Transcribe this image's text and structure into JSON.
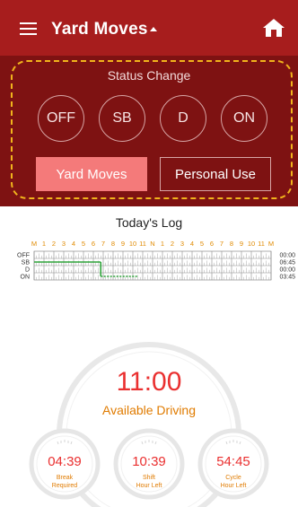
{
  "header": {
    "title": "Yard Moves"
  },
  "status_change": {
    "title": "Status Change",
    "buttons": [
      "OFF",
      "SB",
      "D",
      "ON"
    ],
    "yard_moves_label": "Yard Moves",
    "personal_use_label": "Personal Use"
  },
  "log": {
    "title": "Today's Log",
    "hour_labels": [
      "M",
      "1",
      "2",
      "3",
      "4",
      "5",
      "6",
      "7",
      "8",
      "9",
      "10",
      "11",
      "N",
      "1",
      "2",
      "3",
      "4",
      "5",
      "6",
      "7",
      "8",
      "9",
      "10",
      "11",
      "M"
    ],
    "rows": [
      {
        "label": "OFF",
        "total": "00:00"
      },
      {
        "label": "SB",
        "total": "06:45"
      },
      {
        "label": "D",
        "total": "00:00"
      },
      {
        "label": "ON",
        "total": "03:45"
      }
    ]
  },
  "timers": {
    "available_driving": {
      "value": "11:00",
      "label": "Available Driving"
    },
    "break": {
      "value": "04:39",
      "label_line1": "Break",
      "label_line2": "Required"
    },
    "shift": {
      "value": "10:39",
      "label_line1": "Shift",
      "label_line2": "Hour Left"
    },
    "cycle": {
      "value": "54:45",
      "label_line1": "Cycle",
      "label_line2": "Hour Left"
    }
  },
  "colors": {
    "app_bar": "#a71d1d",
    "status_panel": "#7e1212",
    "highlight_frame": "#f1b41c",
    "yard_moves_active": "#f47a7a",
    "time_red": "#ea3030",
    "label_orange": "#e07b00",
    "log_line": "#2fa33a",
    "hour_label_orange": "#e08a00"
  },
  "icons": {
    "menu": "hamburger-menu-icon",
    "caret": "caret-up-icon",
    "home": "home-icon"
  }
}
